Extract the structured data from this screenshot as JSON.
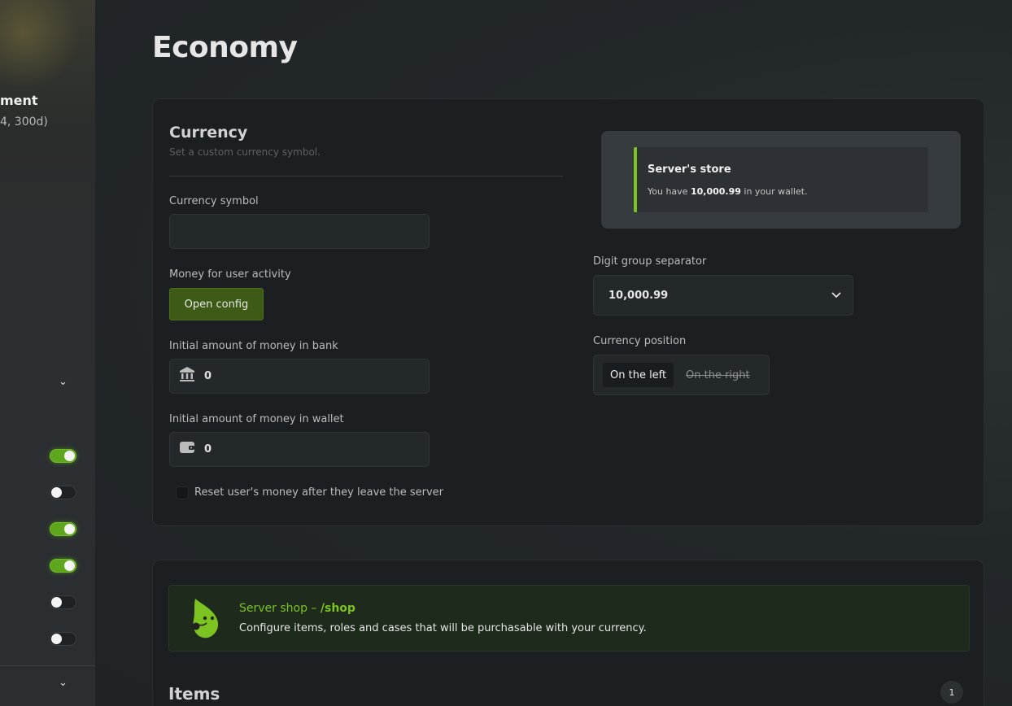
{
  "sidebar": {
    "title": "ment",
    "subtitle": "4, 300d)",
    "chevrons": [
      "⌄",
      "⌄"
    ],
    "toggles": [
      true,
      false,
      true,
      true,
      false,
      false
    ]
  },
  "page": {
    "title": "Economy"
  },
  "currency": {
    "title": "Currency",
    "description": "Set a custom currency symbol.",
    "symbol_label": "Currency symbol",
    "symbol_value": "",
    "activity_label": "Money for user activity",
    "open_config_label": "Open config",
    "bank_label": "Initial amount of money in bank",
    "bank_value": "0",
    "wallet_label": "Initial amount of money in wallet",
    "wallet_value": "0",
    "reset_label": "Reset user's money after they leave the server",
    "reset_checked": false
  },
  "preview": {
    "title": "Server's store",
    "text_prefix": "You have ",
    "amount": "10,000.99",
    "text_suffix": " in your wallet."
  },
  "separator": {
    "label": "Digit group separator",
    "value": "10,000.99"
  },
  "position": {
    "label": "Currency position",
    "left": "On the left",
    "right": "On the right",
    "selected": "left"
  },
  "shop": {
    "title_prefix": "Server shop – ",
    "command": "/shop",
    "description": "Configure items, roles and cases that will be purchasable with your currency."
  },
  "items": {
    "title": "Items",
    "count": "1"
  },
  "colors": {
    "accent": "#7cc322",
    "button": "#3d5a16"
  }
}
